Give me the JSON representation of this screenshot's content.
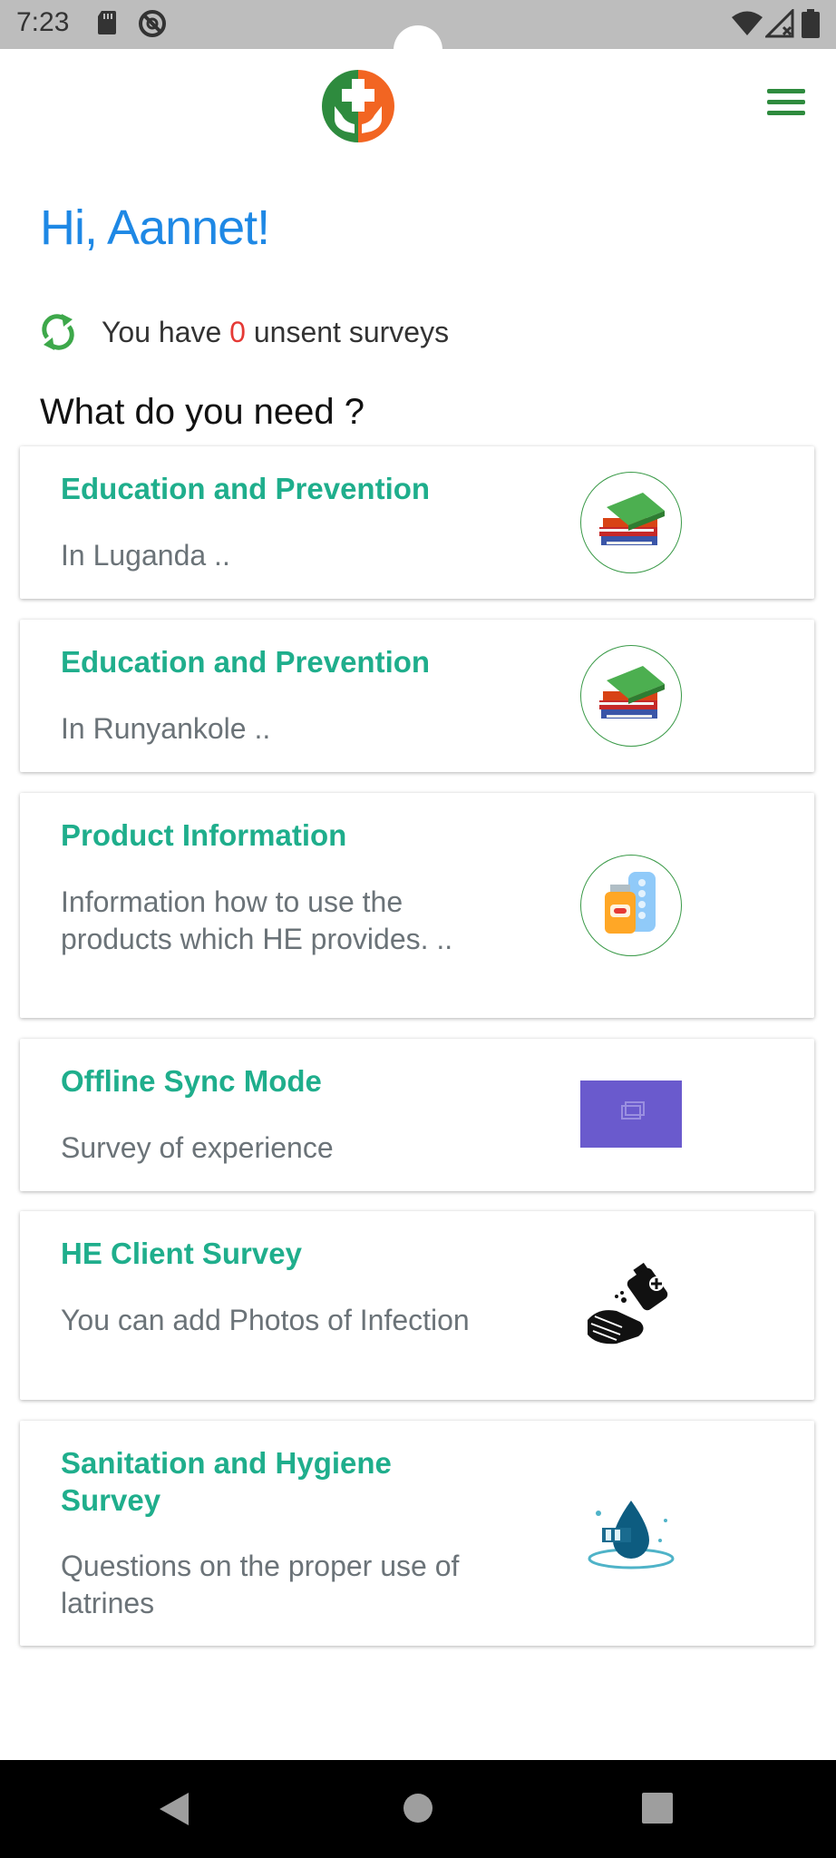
{
  "status_bar": {
    "time": "7:23",
    "icons": [
      "sd-card-icon",
      "do-not-disturb-icon",
      "wifi-icon",
      "signal-icon",
      "battery-icon"
    ]
  },
  "header": {
    "logo_icon": "health-hands-logo-icon",
    "menu_icon": "hamburger-menu-icon"
  },
  "greeting": "Hi, Aannet!",
  "sync": {
    "prefix": "You have",
    "count": "0",
    "suffix": "unsent surveys",
    "icon": "sync-icon"
  },
  "section_title": "What do you need ?",
  "cards": [
    {
      "title": "Education and Prevention",
      "desc": "In Luganda ..",
      "icon": "books-icon"
    },
    {
      "title": "Education and Prevention",
      "desc": "In Runyankole ..",
      "icon": "books-icon"
    },
    {
      "title": "Product Information",
      "desc": "Information how to use the products which HE provides. ..",
      "icon": "medicine-bottle-icon"
    },
    {
      "title": "Offline Sync Mode",
      "desc": "Survey of experience",
      "icon": "image-placeholder-icon"
    },
    {
      "title": "HE Client Survey",
      "desc": "You can add Photos of Infection",
      "icon": "hand-sanitizer-icon"
    },
    {
      "title": "Sanitation and Hygiene Survey",
      "desc": "Questions on the proper use of latrines",
      "icon": "water-drop-icon"
    }
  ],
  "nav_bar": {
    "back_icon": "back-triangle-icon",
    "home_icon": "home-circle-icon",
    "recents_icon": "recents-square-icon"
  },
  "colors": {
    "status_bar": "#bdbdbd",
    "greeting": "#1e88e5",
    "card_title": "#1fae8c",
    "card_desc": "#6b7378",
    "unsent_count": "#e53935",
    "accent_green": "#2e8b3e",
    "placeholder_purple": "#6a5acd"
  }
}
